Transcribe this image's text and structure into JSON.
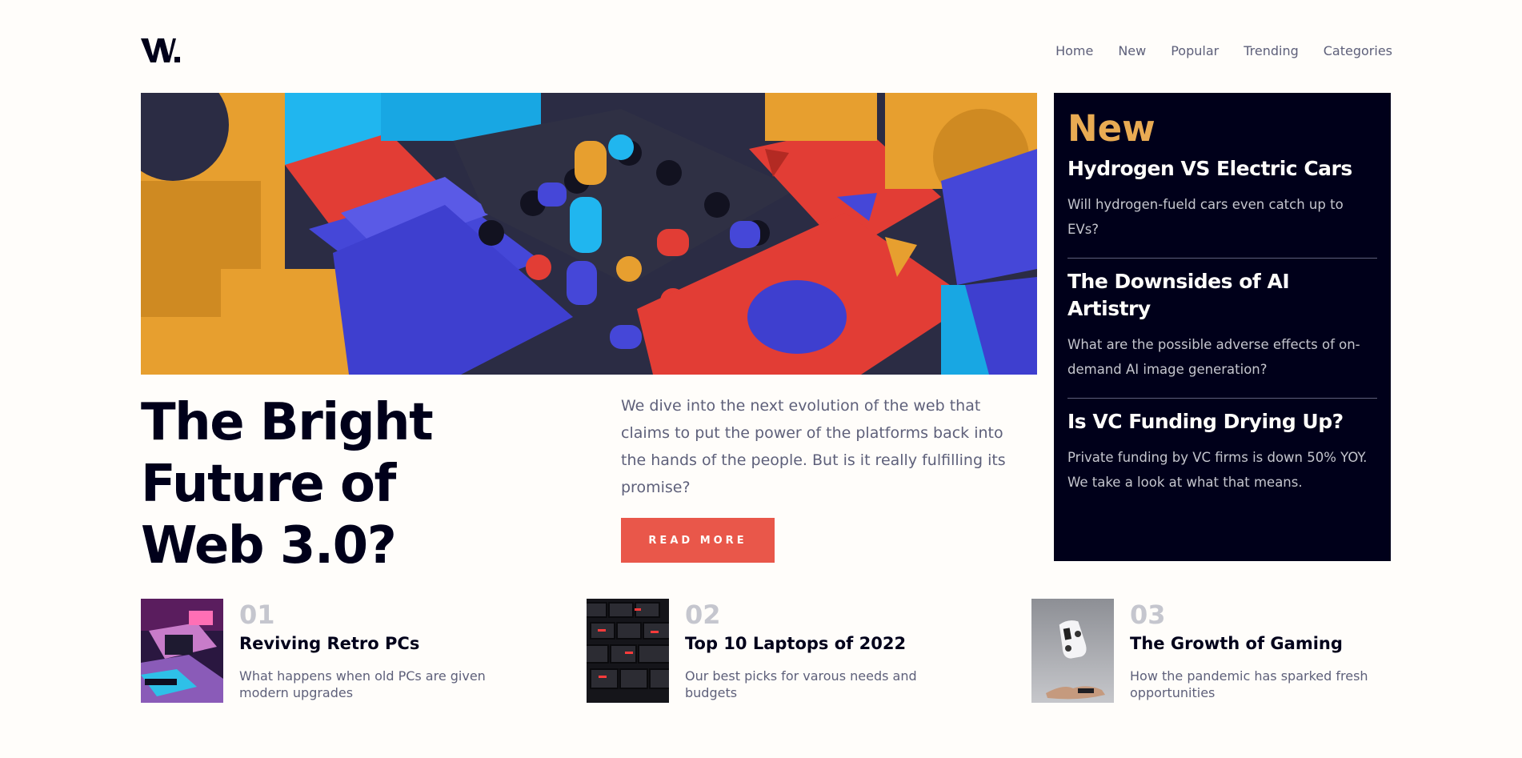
{
  "brand": {
    "logo_text": "W."
  },
  "nav": {
    "items": [
      {
        "label": "Home"
      },
      {
        "label": "New"
      },
      {
        "label": "Popular"
      },
      {
        "label": "Trending"
      },
      {
        "label": "Categories"
      }
    ]
  },
  "hero": {
    "headline_line1": "The Bright",
    "headline_line2": "Future of",
    "headline_line3": "Web 3.0?",
    "intro": "We dive into the next evolution of the web that claims to put the power of the platforms back into the hands of the people. But is it really fulfilling its promise?",
    "read_more_label": "READ MORE"
  },
  "new_panel": {
    "title": "New",
    "items": [
      {
        "title": "Hydrogen VS Electric Cars",
        "desc": "Will hydrogen-fueld cars even catch up to EVs?"
      },
      {
        "title": "The Downsides of AI Artistry",
        "desc": "What are the possible adverse effects of on-demand AI image generation?"
      },
      {
        "title": "Is VC Funding Drying Up?",
        "desc": "Private funding by VC firms is down 50% YOY. We take a look at what that means."
      }
    ]
  },
  "articles": [
    {
      "num": "01",
      "title": "Reviving Retro PCs",
      "desc": "What happens when old PCs are given modern upgrades"
    },
    {
      "num": "02",
      "title": "Top 10 Laptops of 2022",
      "desc": "Our best picks for varous needs and budgets"
    },
    {
      "num": "03",
      "title": "The Growth of Gaming",
      "desc": "How the pandemic has sparked fresh opportunities"
    }
  ],
  "colors": {
    "accent_orange": "#e9ab53",
    "accent_red": "#e9574a",
    "dark_navy": "#00001a",
    "grayish_blue": "#5e607a",
    "light_gray": "#c5c6ce",
    "off_white": "#fffdfa"
  }
}
